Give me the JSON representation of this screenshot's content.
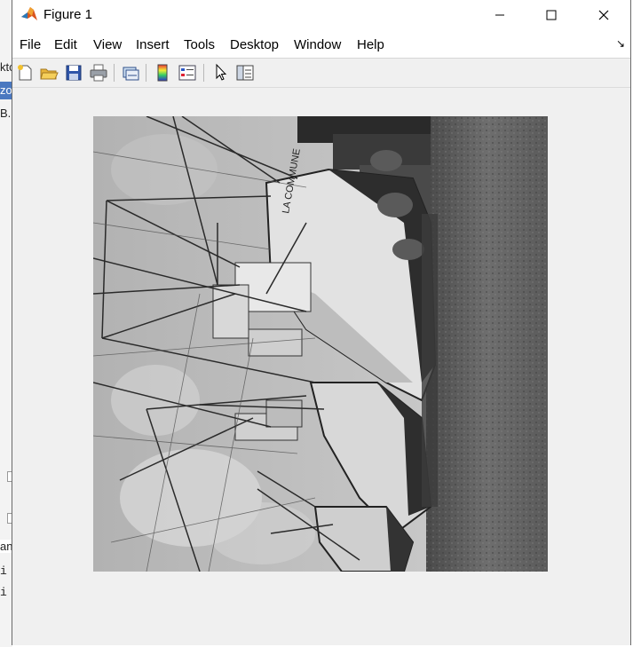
{
  "window": {
    "title": "Figure 1",
    "controls": {
      "minimize": "—",
      "maximize": "☐",
      "close": "✕"
    }
  },
  "menu": {
    "items": [
      {
        "id": "file",
        "label": "File"
      },
      {
        "id": "edit",
        "label": "Edit"
      },
      {
        "id": "view",
        "label": "View"
      },
      {
        "id": "insert",
        "label": "Insert"
      },
      {
        "id": "tools",
        "label": "Tools"
      },
      {
        "id": "desktop",
        "label": "Desktop"
      },
      {
        "id": "window",
        "label": "Window"
      },
      {
        "id": "help",
        "label": "Help"
      }
    ],
    "dock_glyph": "↘"
  },
  "toolbar": {
    "buttons": [
      "new-figure-icon",
      "open-file-icon",
      "save-icon",
      "print-icon",
      "link-plot-icon",
      "insert-colorbar-icon",
      "insert-legend-icon",
      "edit-plot-arrow-icon",
      "property-inspector-icon"
    ]
  },
  "background": {
    "fragments": [
      "ktc",
      "zo",
      "B.n",
      "an",
      "i",
      "i"
    ]
  },
  "figure": {
    "image": "grayscale boat photograph rotated 90°",
    "colormap": "gray"
  }
}
